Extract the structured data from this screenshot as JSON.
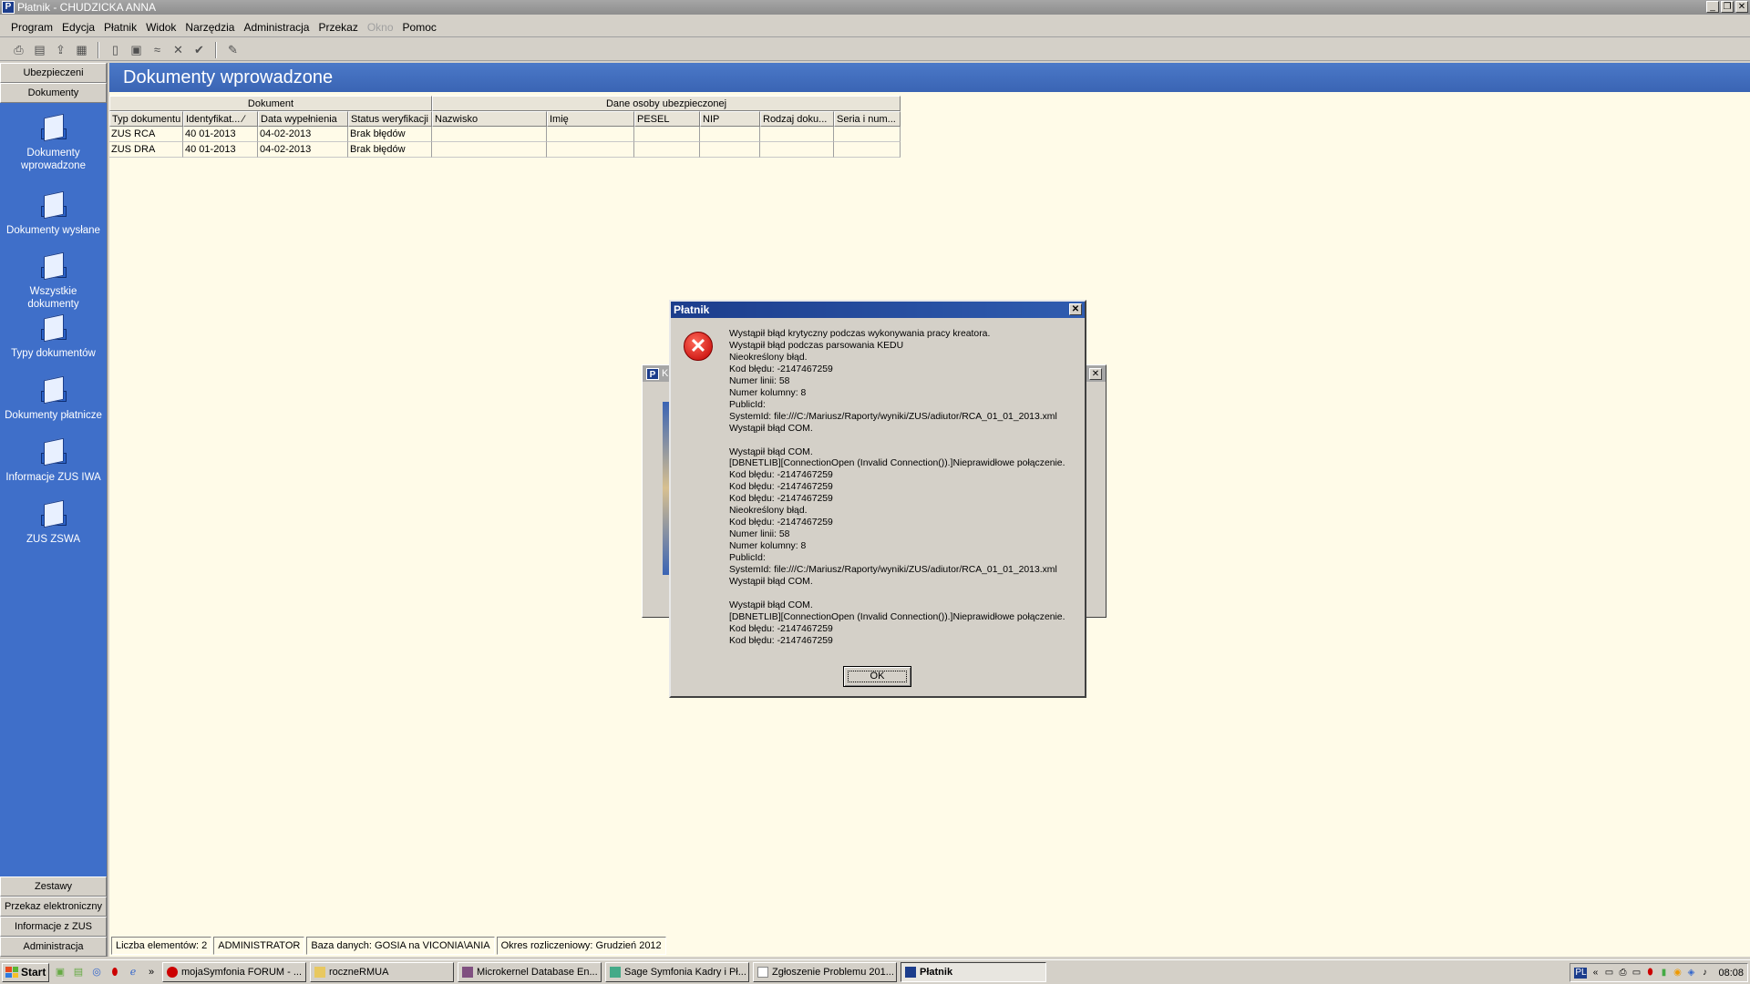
{
  "window": {
    "title": "Płatnik - CHUDZICKA ANNA",
    "app_icon_letter": "P"
  },
  "menu": {
    "items": [
      "Program",
      "Edycja",
      "Płatnik",
      "Widok",
      "Narzędzia",
      "Administracja",
      "Przekaz",
      "Okno",
      "Pomoc"
    ],
    "disabled_index": 7
  },
  "toolbar": {
    "icons": [
      "print-icon",
      "print-preview-icon",
      "export-icon",
      "report-icon",
      "new-document-icon",
      "open-document-icon",
      "hide-icon",
      "delete-icon",
      "verify-icon",
      "wizard-icon"
    ]
  },
  "leftnav": {
    "top_tabs": [
      "Ubezpieczeni",
      "Dokumenty"
    ],
    "items": [
      "Dokumenty wprowadzone",
      "Dokumenty wysłane",
      "Wszystkie dokumenty",
      "Typy dokumentów",
      "Dokumenty płatnicze",
      "Informacje ZUS IWA",
      "ZUS ZSWA"
    ],
    "bottom_tabs": [
      "Zestawy",
      "Przekaz elektroniczny",
      "Informacje z ZUS",
      "Administracja"
    ]
  },
  "main": {
    "title": "Dokumenty wprowadzone"
  },
  "grid": {
    "group_headers": [
      "Dokument",
      "Dane osoby ubezpieczonej"
    ],
    "columns": [
      "Typ dokumentu",
      "Identyfikat... ∕",
      "Data wypełnienia",
      "Status weryfikacji",
      "Nazwisko",
      "Imię",
      "PESEL",
      "NIP",
      "Rodzaj doku...",
      "Seria i num..."
    ],
    "rows": [
      [
        "ZUS RCA",
        "40 01-2013",
        "04-02-2013",
        "Brak błędów",
        "",
        "",
        "",
        "",
        "",
        ""
      ],
      [
        "ZUS DRA",
        "40 01-2013",
        "04-02-2013",
        "Brak błędów",
        "",
        "",
        "",
        "",
        "",
        ""
      ]
    ]
  },
  "statusbar": {
    "count": "Liczba elementów: 2",
    "user": "ADMINISTRATOR",
    "database": "Baza danych: GOSIA na VICONIA\\ANIA",
    "period": "Okres rozliczeniowy: Grudzień 2012"
  },
  "dialog": {
    "title": "Płatnik",
    "message": "Wystąpił błąd krytyczny podczas wykonywania pracy kreatora.\nWystąpił błąd podczas parsowania KEDU\nNieokreślony błąd.\nKod błędu: -2147467259\nNumer linii: 58\nNumer kolumny: 8\nPublicId:\nSystemId: file:///C:/Mariusz/Raporty/wyniki/ZUS/adiutor/RCA_01_01_2013.xml\nWystąpił błąd COM.\n\nWystąpił błąd COM.\n[DBNETLIB][ConnectionOpen (Invalid Connection()).]Nieprawidłowe połączenie.\nKod błędu: -2147467259\nKod błędu: -2147467259\nKod błędu: -2147467259\nNieokreślony błąd.\nKod błędu: -2147467259\nNumer linii: 58\nNumer kolumny: 8\nPublicId:\nSystemId: file:///C:/Mariusz/Raporty/wyniki/ZUS/adiutor/RCA_01_01_2013.xml\nWystąpił błąd COM.\n\nWystąpił błąd COM.\n[DBNETLIB][ConnectionOpen (Invalid Connection()).]Nieprawidłowe połączenie.\nKod błędu: -2147467259\nKod błędu: -2147467259",
    "ok_label": "OK"
  },
  "bg_dialog": {
    "title_fragment": "K"
  },
  "taskbar": {
    "start_label": "Start",
    "buttons": [
      "mojaSymfonia FORUM - ...",
      "roczneRMUA",
      "Microkernel Database En...",
      "Sage Symfonia Kadry i Pł...",
      "Zgłoszenie Problemu 201...",
      "Płatnik"
    ],
    "active_index": 5,
    "tray_lang": "PL",
    "clock": "08:08"
  },
  "colors": {
    "nav_blue": "#3f6fc9",
    "header_blue": "#3a64b4",
    "content_bg": "#fffbe8",
    "error_red": "#c00000"
  }
}
